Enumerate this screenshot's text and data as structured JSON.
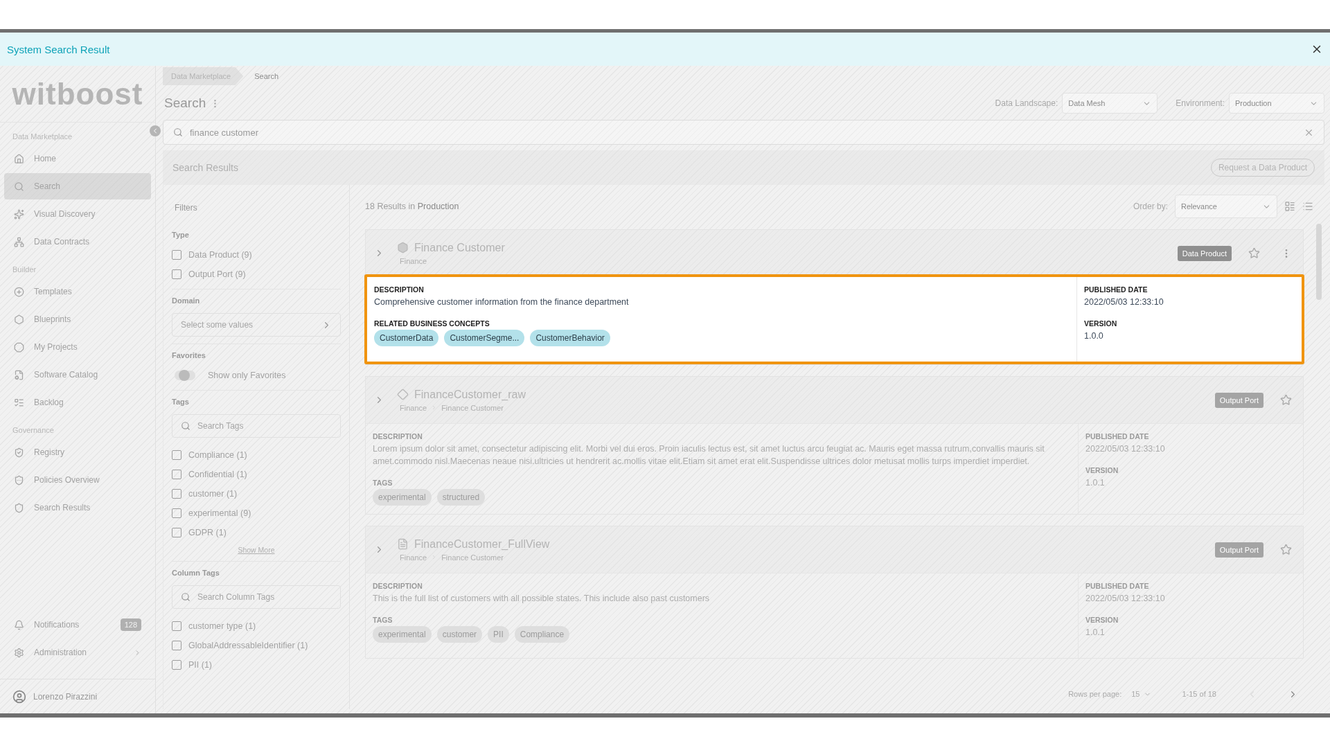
{
  "window": {
    "title": "System Search Result"
  },
  "sidebar": {
    "logo": "witboost",
    "sections": [
      {
        "title": "Data Marketplace",
        "items": [
          {
            "label": "Home",
            "selected": false
          },
          {
            "label": "Search",
            "selected": true
          },
          {
            "label": "Visual Discovery",
            "selected": false
          },
          {
            "label": "Data Contracts",
            "selected": false
          }
        ]
      },
      {
        "title": "Builder",
        "items": [
          {
            "label": "Templates",
            "selected": false
          },
          {
            "label": "Blueprints",
            "selected": false
          },
          {
            "label": "My Projects",
            "selected": false
          },
          {
            "label": "Software Catalog",
            "selected": false
          },
          {
            "label": "Backlog",
            "selected": false
          }
        ]
      },
      {
        "title": "Governance",
        "items": [
          {
            "label": "Registry",
            "selected": false
          },
          {
            "label": "Policies Overview",
            "selected": false
          },
          {
            "label": "Search Results",
            "selected": false
          }
        ]
      }
    ],
    "bottom_items": [
      {
        "label": "Notifications",
        "badge": "128"
      },
      {
        "label": "Administration",
        "expandable": true
      }
    ],
    "user": {
      "name": "Lorenzo Pirazzini"
    }
  },
  "breadcrumbs": [
    {
      "label": "Data Marketplace",
      "current": false
    },
    {
      "label": "Search",
      "current": true
    }
  ],
  "page": {
    "title": "Search"
  },
  "selectors": [
    {
      "label": "Data Landscape:",
      "value": "Data Mesh"
    },
    {
      "label": "Environment:",
      "value": "Production"
    }
  ],
  "search": {
    "value": "finance customer"
  },
  "results_header": {
    "title": "Search Results",
    "button": "Request a Data Product"
  },
  "filters": {
    "title": "Filters",
    "sections": [
      {
        "kind": "checks",
        "title": "Type",
        "options": [
          {
            "label": "Data Product (9)",
            "checked": false
          },
          {
            "label": "Output Port (9)",
            "checked": false
          }
        ]
      },
      {
        "kind": "select",
        "title": "Domain",
        "placeholder": "Select some values"
      },
      {
        "kind": "toggle",
        "title": "Favorites",
        "label": "Show only Favorites",
        "on": false
      },
      {
        "kind": "search-checks",
        "title": "Tags",
        "placeholder": "Search Tags",
        "options": [
          {
            "label": "Compliance (1)",
            "checked": false
          },
          {
            "label": "Confidential (1)",
            "checked": false
          },
          {
            "label": "customer (1)",
            "checked": false
          },
          {
            "label": "experimental (9)",
            "checked": false
          },
          {
            "label": "GDPR (1)",
            "checked": false
          }
        ],
        "more": "Show More"
      },
      {
        "kind": "search-checks",
        "title": "Column Tags",
        "placeholder": "Search Column Tags",
        "options": [
          {
            "label": "customer type (1)",
            "checked": false
          },
          {
            "label": "GlobalAddressableIdentifier (1)",
            "checked": false
          },
          {
            "label": "PII (1)",
            "checked": false
          }
        ]
      }
    ]
  },
  "results": {
    "summary": "18 Results in **Production**",
    "order_label": "Order by:",
    "order_value": "Relevance",
    "cards": [
      {
        "title": "Finance Customer",
        "path": [
          "Finance"
        ],
        "badge": "Data Product",
        "menu": true,
        "highlighted": true,
        "description": "Comprehensive customer information from the finance department",
        "chips_label": "RELATED BUSINESS CONCEPTS",
        "chips": [
          "CustomerData",
          "CustomerSegme...",
          "CustomerBehavior"
        ],
        "published_label": "PUBLISHED DATE",
        "published": "2022/05/03 12:33:10",
        "version_label": "VERSION",
        "version": "1.0.0",
        "description_label": "DESCRIPTION"
      },
      {
        "title": "FinanceCustomer_raw",
        "path": [
          "Finance",
          "Finance Customer"
        ],
        "badge": "Output Port",
        "menu": false,
        "highlighted": false,
        "description": "Lorem ipsum dolor sit amet, consectetur adipiscing elit. Morbi vel dui eros. Proin iaculis lectus est, sit amet luctus arcu feugiat ac. Mauris eget massa rutrum,convallis mauris sit amet.commodo nisl.Maecenas neaue nisi.ultricies ut hendrerit ac.mollis vitae elit.Etiam sit amet erat elit.Suspendisse ultrices dolor metusat mollis turps imperdiet imperdiet.",
        "chips_label": "TAGS",
        "chips": [
          "experimental",
          "structured"
        ],
        "published_label": "PUBLISHED DATE",
        "published": "2022/05/03 12:33:10",
        "version_label": "VERSION",
        "version": "1.0.1",
        "description_label": "DESCRIPTION"
      },
      {
        "title": "FinanceCustomer_FullView",
        "path": [
          "Finance",
          "Finance Customer"
        ],
        "badge": "Output Port",
        "menu": false,
        "highlighted": false,
        "description": "This is the full list of customers with all possible states. This include also past customers",
        "chips_label": "TAGS",
        "chips": [
          "experimental",
          "customer",
          "PII",
          "Compliance"
        ],
        "published_label": "PUBLISHED DATE",
        "published": "2022/05/03 12:33:10",
        "version_label": "VERSION",
        "version": "1.0.1",
        "description_label": "DESCRIPTION"
      }
    ]
  },
  "pagination": {
    "rows_label": "Rows per page:",
    "rows_value": "15",
    "range": "1-15 of 18"
  }
}
